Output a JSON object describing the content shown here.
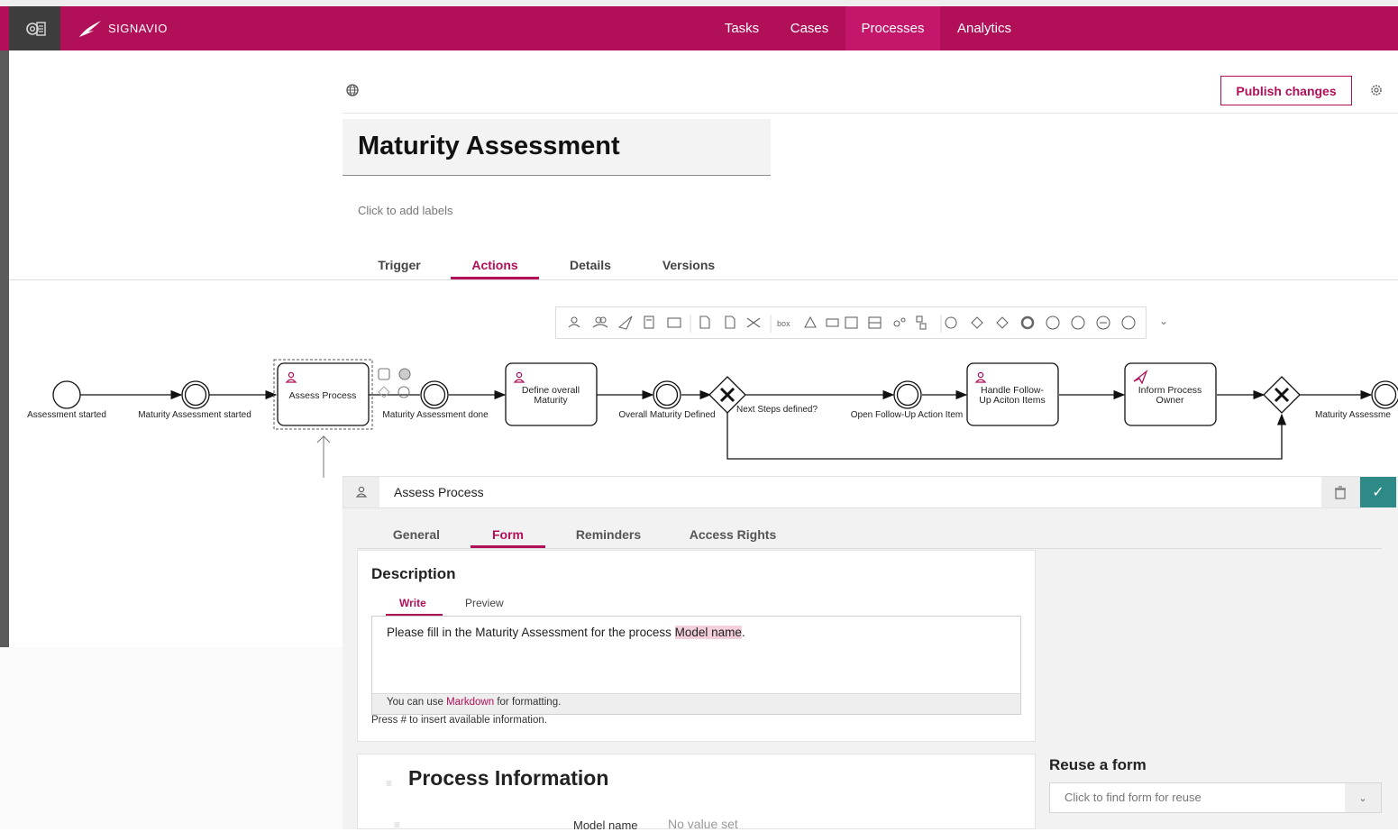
{
  "topbar": {
    "brand": "SIGNAVIO",
    "nav": [
      {
        "label": "Tasks"
      },
      {
        "label": "Cases"
      },
      {
        "label": "Processes"
      },
      {
        "label": "Analytics"
      }
    ],
    "active_nav": "Processes"
  },
  "header": {
    "publish_label": "Publish changes",
    "title": "Maturity Assessment",
    "labels_hint": "Click to add labels",
    "tabs": [
      {
        "label": "Trigger"
      },
      {
        "label": "Actions"
      },
      {
        "label": "Details"
      },
      {
        "label": "Versions"
      }
    ],
    "active_tab": "Actions"
  },
  "diagram": {
    "events": [
      {
        "label": "Assessment started"
      },
      {
        "label": "Maturity Assessment started"
      },
      {
        "label": "Maturity Assessment done"
      },
      {
        "label": "Overall Maturity Defined"
      },
      {
        "label": "Open Follow-Up Action Item"
      },
      {
        "label": "Maturity Assessme"
      }
    ],
    "tasks": [
      {
        "label": "Assess Process",
        "icon": "user-task-icon"
      },
      {
        "label_lines": [
          "Define overall",
          "Maturity"
        ],
        "icon": "user-task-icon"
      },
      {
        "label_lines": [
          "Handle Follow-",
          "Up Aciton Items"
        ],
        "icon": "user-task-icon"
      },
      {
        "label_lines": [
          "Inform Process",
          "Owner"
        ],
        "icon": "send-task-icon"
      }
    ],
    "gateway_label": "Next Steps defined?"
  },
  "panel": {
    "task_name": "Assess Process",
    "tabs": [
      {
        "label": "General"
      },
      {
        "label": "Form"
      },
      {
        "label": "Reminders"
      },
      {
        "label": "Access Rights"
      }
    ],
    "active_tab": "Form",
    "description": {
      "title": "Description",
      "write_tab": "Write",
      "preview_tab": "Preview",
      "text_before": "Please fill in the Maturity Assessment for the process ",
      "text_highlight": "Model name",
      "text_after": ".",
      "md_before": "You can use ",
      "md_link": "Markdown",
      "md_after": " for formatting.",
      "hash_hint": "Press # to insert available information."
    },
    "process_info": {
      "title": "Process Information",
      "field_label": "Model name",
      "field_value": "No value set"
    },
    "reuse": {
      "title": "Reuse a form",
      "placeholder": "Click to find form for reuse"
    }
  },
  "colors": {
    "brand": "#b10f57",
    "confirm": "#2e8a86"
  }
}
